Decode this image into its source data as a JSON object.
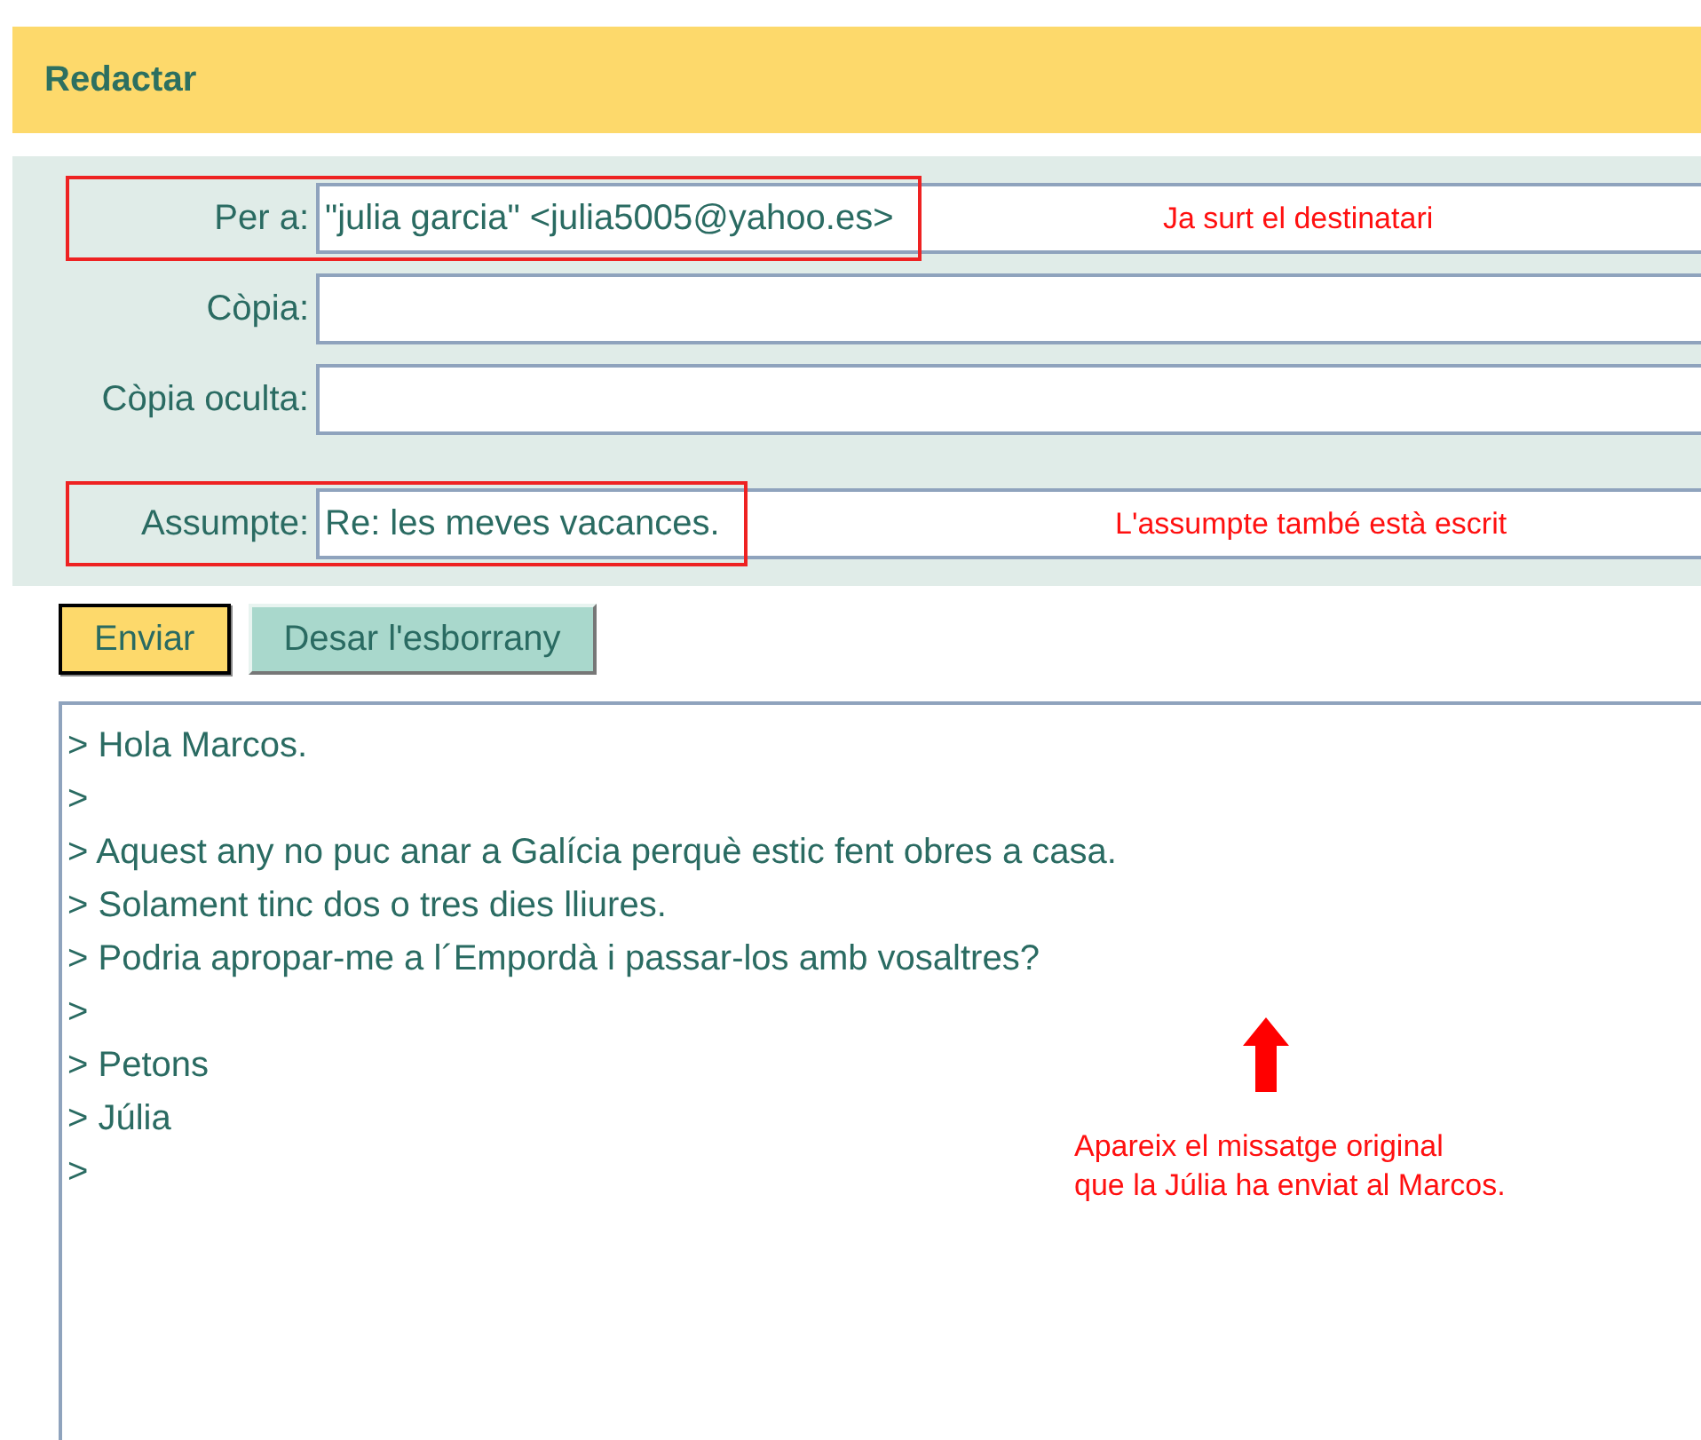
{
  "header": {
    "title": "Redactar"
  },
  "fields": [
    {
      "label": "Per a:",
      "value": "\"julia garcia\" <julia5005@yahoo.es>",
      "highlighted": true,
      "annotation": "Ja surt el destinatari"
    },
    {
      "label": "Còpia:",
      "highlighted": false
    },
    {
      "label": "Còpia oculta:",
      "highlighted": false
    },
    {
      "label": "Assumpte:",
      "value": "Re: les meves vacances.",
      "highlighted": true,
      "annotation": "L'assumpte també està escrit"
    }
  ],
  "buttons": [
    {
      "label": "Enviar",
      "kind": "primary"
    },
    {
      "label": "Desar l'esborrany",
      "kind": "secondary"
    }
  ],
  "message": {
    "lines": [
      "> Hola Marcos.",
      ">",
      "> Aquest any no puc anar a Galícia perquè estic fent obres a casa.",
      "> Solament tinc dos o tres dies lliures.",
      "> Podria apropar-me a l´Empordà i passar-los amb vosaltres?",
      ">",
      "> Petons",
      "> Júlia",
      ">"
    ],
    "annotation": [
      "Apareix el missatge original",
      "que la Júlia ha enviat al Marcos."
    ]
  }
}
